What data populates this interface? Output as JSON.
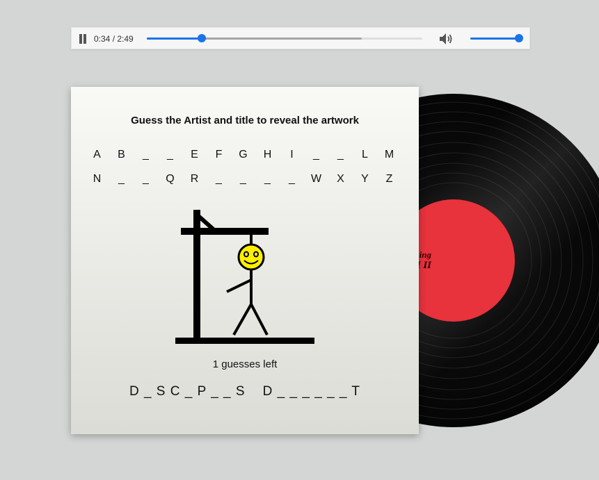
{
  "player": {
    "time": "0:34 / 2:49",
    "progress_fraction": 0.2,
    "buffered_fraction": 0.78,
    "volume_fraction": 1.0
  },
  "record": {
    "label_text_top": "ging",
    "label_text_bottom": "I II",
    "label_color": "#e8323c"
  },
  "game": {
    "title": "Guess the Artist and title to reveal the artwork",
    "letter_rows": [
      [
        "A",
        "B",
        "_",
        "_",
        "E",
        "F",
        "G",
        "H",
        "I",
        "_",
        "_",
        "L",
        "M"
      ],
      [
        "N",
        "_",
        "_",
        "Q",
        "R",
        "_",
        "_",
        "_",
        "_",
        "W",
        "X",
        "Y",
        "Z"
      ]
    ],
    "guesses_left": "1 guesses left",
    "answer": "D _ S C _ P _ _ S    D _ _ _ _ _ _ T",
    "accent_color": "#1a73e8",
    "face_color": "#ffee00"
  }
}
